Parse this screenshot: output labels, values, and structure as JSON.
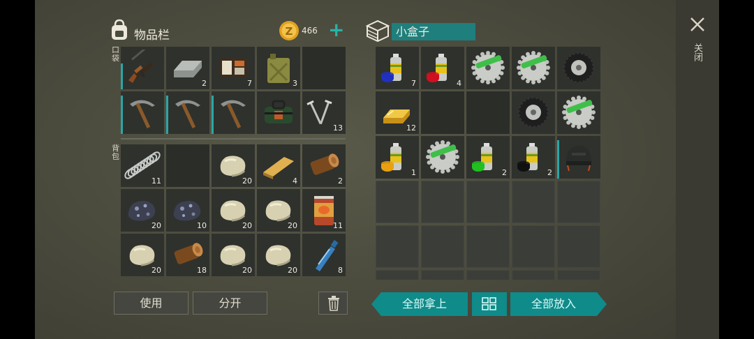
{
  "inventory": {
    "title": "物品栏",
    "coin_amount": "466",
    "plus_symbol": "+",
    "pocket_label": "口袋",
    "backpack_label": "背包",
    "pocket_slots": [
      {
        "item": "ak-rifle-icon",
        "qty": ""
      },
      {
        "item": "metal-ingot-icon",
        "qty": "2"
      },
      {
        "item": "wallet-icon",
        "qty": "7"
      },
      {
        "item": "jerrycan-icon",
        "qty": "3"
      },
      {
        "item": "",
        "qty": ""
      },
      {
        "item": "pickaxe-icon",
        "qty": ""
      },
      {
        "item": "pickaxe-icon",
        "qty": ""
      },
      {
        "item": "pickaxe-icon",
        "qty": ""
      },
      {
        "item": "medkit-bag-icon",
        "qty": ""
      },
      {
        "item": "nails-icon",
        "qty": "13"
      }
    ],
    "backpack_slots": [
      {
        "item": "spring-icon",
        "qty": "11"
      },
      {
        "item": "",
        "qty": ""
      },
      {
        "item": "stone-icon",
        "qty": "20"
      },
      {
        "item": "plank-icon",
        "qty": "4"
      },
      {
        "item": "log-icon",
        "qty": "2"
      },
      {
        "item": "coal-ore-icon",
        "qty": "20"
      },
      {
        "item": "coal-ore-icon",
        "qty": "10"
      },
      {
        "item": "stone-icon",
        "qty": "20"
      },
      {
        "item": "stone-icon",
        "qty": "20"
      },
      {
        "item": "food-can-icon",
        "qty": "11"
      },
      {
        "item": "stone-icon",
        "qty": "20"
      },
      {
        "item": "log-icon",
        "qty": "18"
      },
      {
        "item": "stone-icon",
        "qty": "20"
      },
      {
        "item": "stone-icon",
        "qty": "20"
      },
      {
        "item": "water-bottle-icon",
        "qty": "8"
      }
    ]
  },
  "buttons": {
    "use": "使用",
    "split": "分开",
    "take_all": "全部拿上",
    "put_all": "全部放入"
  },
  "container": {
    "title": "小盒子",
    "slots": [
      {
        "item": "spray-paint-blue-icon",
        "qty": "7"
      },
      {
        "item": "spray-paint-red-icon",
        "qty": "4"
      },
      {
        "item": "saw-blade-icon",
        "qty": ""
      },
      {
        "item": "saw-blade-icon",
        "qty": ""
      },
      {
        "item": "tire-icon",
        "qty": ""
      },
      {
        "item": "gold-bar-icon",
        "qty": "12"
      },
      {
        "item": "",
        "qty": ""
      },
      {
        "item": "",
        "qty": ""
      },
      {
        "item": "tire-icon",
        "qty": ""
      },
      {
        "item": "saw-blade-icon",
        "qty": ""
      },
      {
        "item": "spray-paint-yellow-icon",
        "qty": "1"
      },
      {
        "item": "saw-blade-icon",
        "qty": ""
      },
      {
        "item": "spray-paint-green-icon",
        "qty": "2"
      },
      {
        "item": "spray-paint-black-icon",
        "qty": "2"
      },
      {
        "item": "helmet-icon",
        "qty": ""
      }
    ],
    "empty_rows": 3
  },
  "close_label": "关闭",
  "colors": {
    "accent_teal": "#0f8b8a",
    "durability_bar": "#2aa6a8",
    "coin": "#e0a020"
  }
}
